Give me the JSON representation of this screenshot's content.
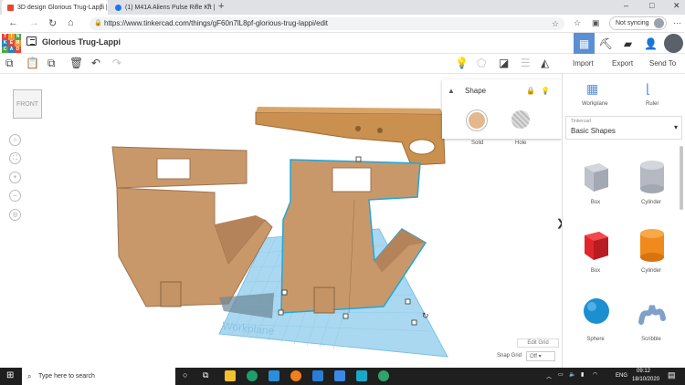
{
  "browser": {
    "tabs": [
      {
        "title": "3D design Glorious Trug-Lappi |",
        "close": "×"
      },
      {
        "title": "(1) M41A Aliens Pulse Rifle Kit |",
        "close": "×"
      }
    ],
    "new_tab": "+",
    "window_controls": {
      "minimize": "–",
      "maximize": "□",
      "close": "✕"
    },
    "url": "https://www.tinkercad.com/things/gF60n7lL8pf-glorious-trug-lappi/edit",
    "sync_label": "Not syncing"
  },
  "app": {
    "logo_letters": [
      "T",
      "I",
      "N",
      "K",
      "E",
      "R",
      "C",
      "A",
      "D"
    ],
    "logo_colors": [
      "#e94434",
      "#f29a33",
      "#50a646",
      "#2b80c5",
      "#e94434",
      "#f29a33",
      "#50a646",
      "#2b80c5",
      "#e94434"
    ],
    "design_title": "Glorious Trug-Lappi"
  },
  "toolbar": {
    "import": "Import",
    "export": "Export",
    "send_to": "Send To"
  },
  "shape_panel": {
    "title": "Shape",
    "solid_label": "Solid",
    "hole_label": "Hole"
  },
  "viewport": {
    "viewcube_label": "FRONT",
    "workplane_text": "Workplane",
    "edit_grid": "Edit Grid",
    "snap_grid_label": "Snap Grid",
    "snap_grid_value": "Off"
  },
  "right_panel": {
    "workplane": "Workplane",
    "ruler": "Ruler",
    "library_source": "Tinkercad",
    "library_name": "Basic Shapes",
    "shapes": [
      {
        "label": "Box",
        "color": "#b4b9c2"
      },
      {
        "label": "Cylinder",
        "color": "#b4b9c2"
      },
      {
        "label": "Box",
        "color": "#e0262c"
      },
      {
        "label": "Cylinder",
        "color": "#f08a1c"
      },
      {
        "label": "Sphere",
        "color": "#1c8fd0"
      },
      {
        "label": "Scribble",
        "color": "#7ea0c9"
      }
    ]
  },
  "taskbar": {
    "search_placeholder": "Type here to search",
    "language": "ENG",
    "time": "09:12",
    "date": "18/10/2020"
  }
}
